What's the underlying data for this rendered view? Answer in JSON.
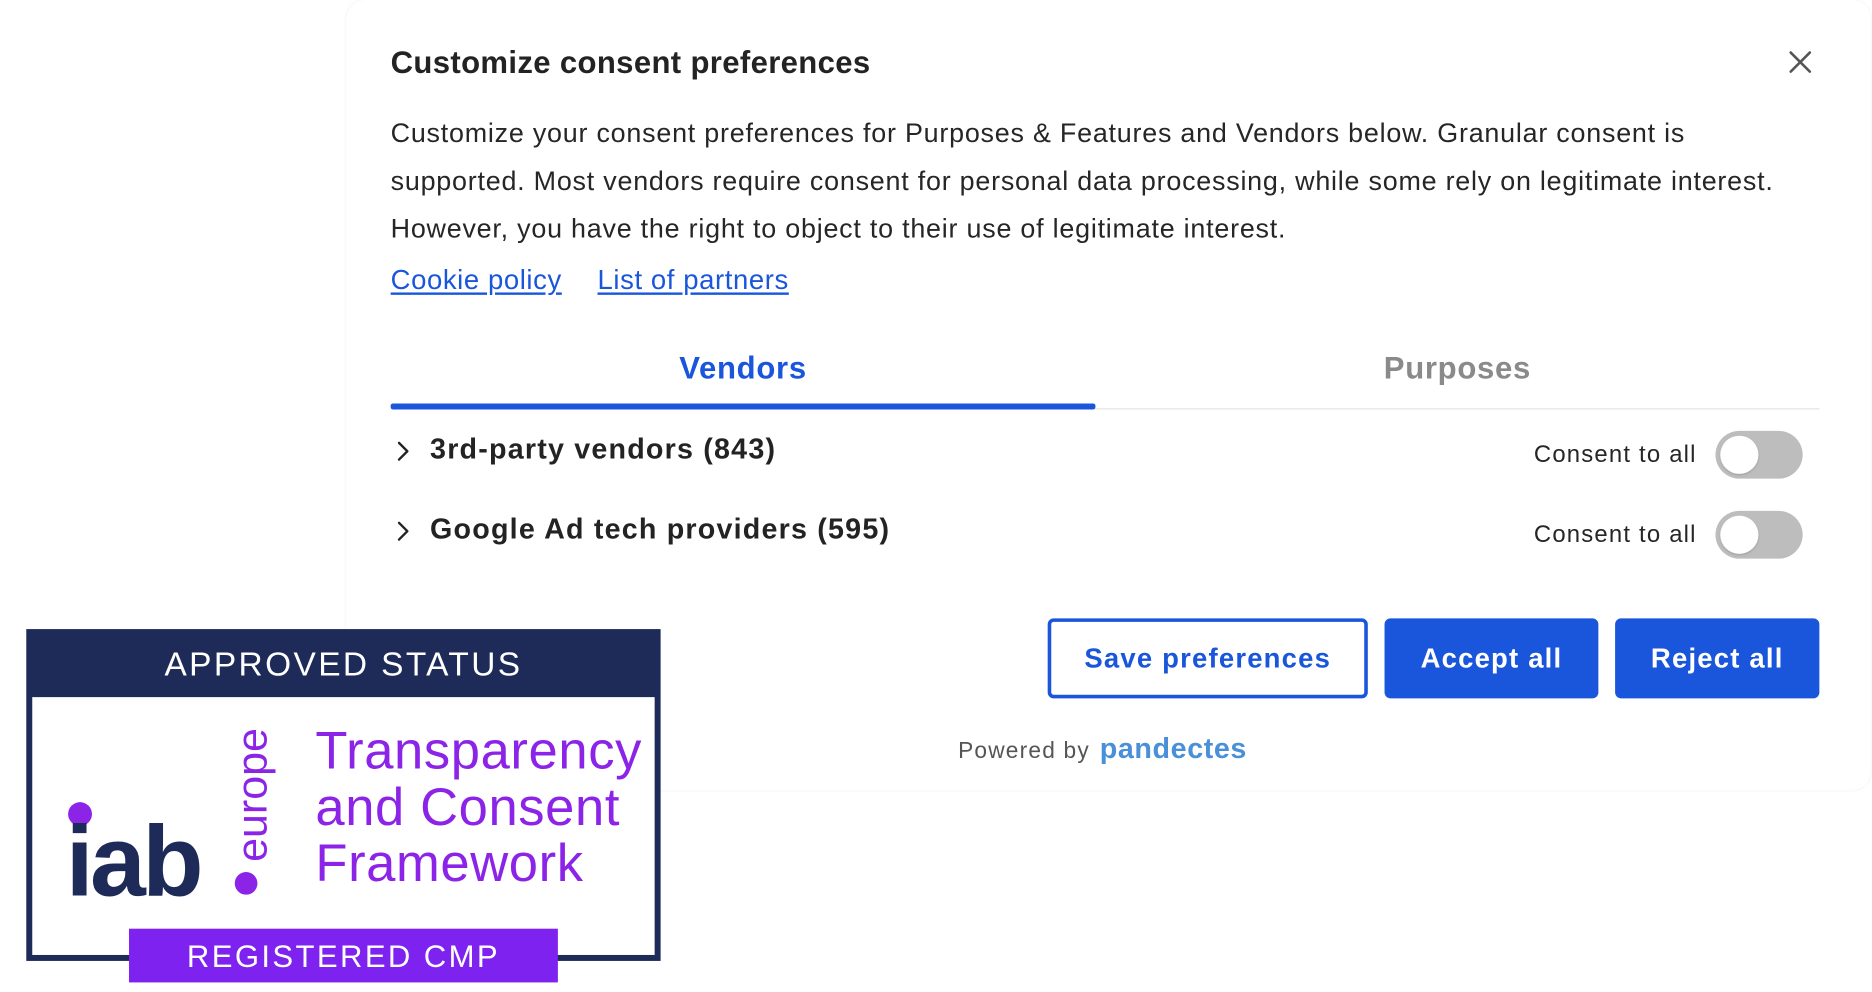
{
  "dialog": {
    "title": "Customize consent preferences",
    "close_icon": "close-icon",
    "description": "Customize your consent preferences for Purposes & Features and Vendors below. Granular consent is supported. Most vendors require consent for personal data processing, while some rely on legitimate interest. However, you have the right to object to their use of legitimate interest.",
    "links": {
      "cookie_policy": "Cookie policy",
      "list_of_partners": "List of partners"
    }
  },
  "tabs": [
    {
      "label": "Vendors",
      "active": true
    },
    {
      "label": "Purposes",
      "active": false
    }
  ],
  "vendor_groups": [
    {
      "label": "3rd-party vendors (843)",
      "consent_label": "Consent to all",
      "enabled": false,
      "icon": "chevron-right-icon"
    },
    {
      "label": "Google Ad tech providers (595)",
      "consent_label": "Consent to all",
      "enabled": false,
      "icon": "chevron-right-icon"
    }
  ],
  "actions": {
    "save_label": "Save preferences",
    "accept_label": "Accept all",
    "reject_label": "Reject all"
  },
  "footer": {
    "powered_by": "Powered by",
    "brand": "pandectes"
  },
  "badge": {
    "header": "APPROVED STATUS",
    "logo_text": "iab",
    "logo_subtext": "europe",
    "title_line1": "Transparency",
    "title_line2": "and Consent",
    "title_line3": "Framework",
    "footer": "REGISTERED CMP"
  },
  "colors": {
    "accent": "#1a56db",
    "toggle_off": "#bdbdbd",
    "badge_navy": "#1e2b58",
    "badge_purple": "#7e22f0",
    "badge_text_purple": "#8c24e8",
    "brand_blue": "#4a90d9"
  }
}
